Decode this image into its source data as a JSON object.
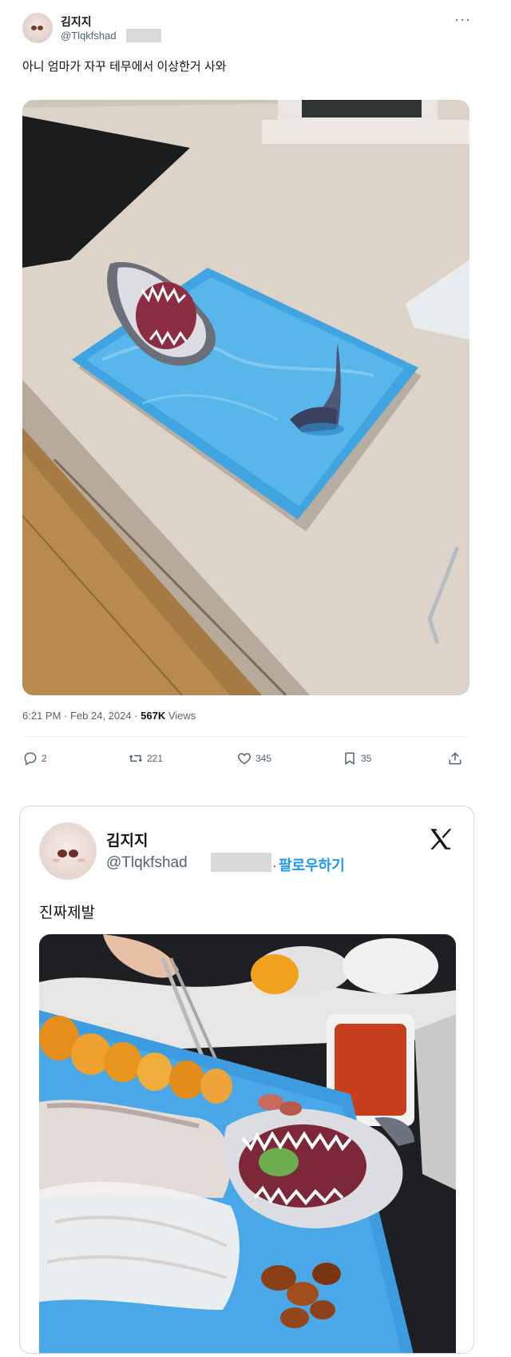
{
  "tweet1": {
    "author_name": "김지지",
    "handle": "@Tlqkfshad",
    "text": "아니 엄마가 자꾸 테무에서 이상한거 사와",
    "timestamp": "6:21 PM · Feb 24, 2024 · ",
    "views_count": "567K",
    "views_label": " Views",
    "actions": {
      "replies": "2",
      "reposts": "221",
      "likes": "345",
      "bookmarks": "35"
    },
    "icons": [
      "more-icon",
      "reply-icon",
      "repost-icon",
      "like-icon",
      "bookmark-icon",
      "share-icon"
    ]
  },
  "tweet2": {
    "author_name": "김지지",
    "handle": "@Tlqkfshad",
    "follow_separator": "·",
    "follow_label": "팔로우하기",
    "text": "진짜제발",
    "icons": [
      "x-logo-icon"
    ]
  },
  "colors": {
    "accent": "#1d9bf0",
    "secondary_text": "#536471",
    "tray_blue": "#3fa4df",
    "countertop": "#ddd3c8"
  }
}
